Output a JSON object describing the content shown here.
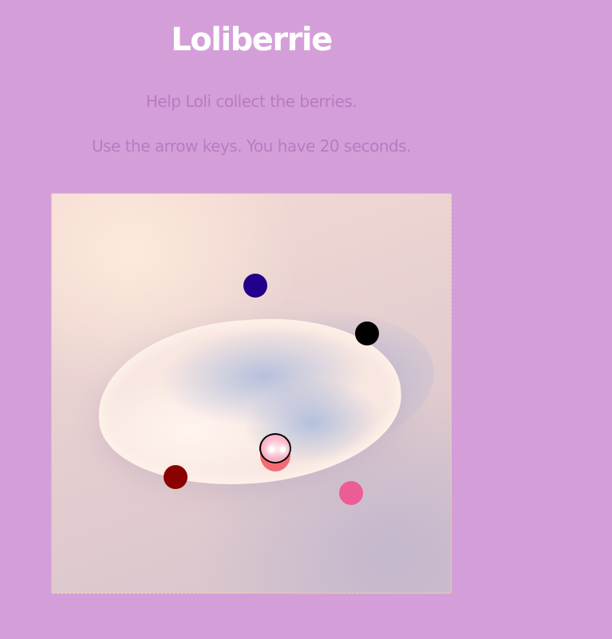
{
  "header": {
    "title": "Loliberrie",
    "instruction_1": "Help Loli collect the berries.",
    "instruction_2": "Use the arrow keys. You have 20 seconds."
  },
  "colors": {
    "page_background": "#d49fd8",
    "title_text": "#ffffff",
    "instruction_text": "#b97ac2",
    "board_border": "#e8c97a",
    "berry_blue": "#23008a",
    "berry_black": "#000000",
    "berry_red": "#8b0000",
    "berry_pink": "#ec5c95",
    "loli_body": "#f56b74",
    "loli_head": "#f7a9c0"
  },
  "game": {
    "player": "Loli",
    "berries": [
      "berry-blue",
      "berry-black",
      "berry-red",
      "berry-pink"
    ]
  }
}
